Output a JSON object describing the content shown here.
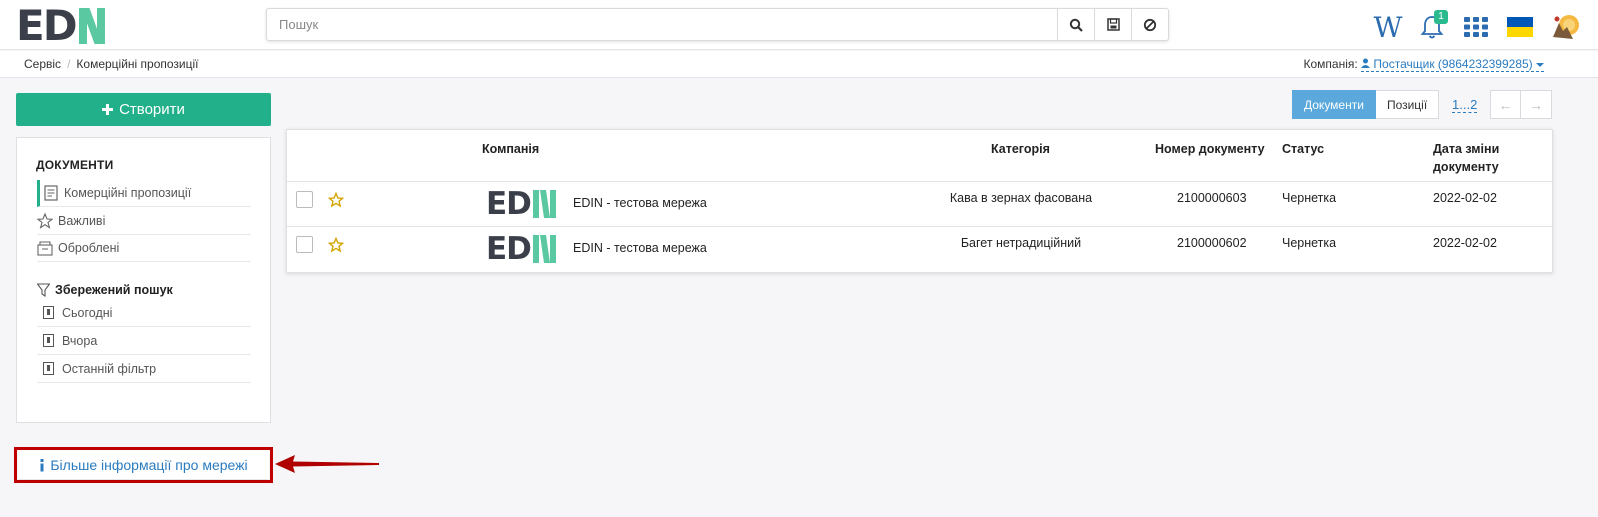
{
  "brand": {
    "logo_text": "ED",
    "accent": "#5ac8a0"
  },
  "search": {
    "placeholder": "Пошук"
  },
  "header": {
    "notifications_count": "1"
  },
  "breadcrumb": [
    "Сервіс",
    "Комерційні пропозиції"
  ],
  "company": {
    "label": "Компанія:",
    "value": "Постачщик (9864232399285)"
  },
  "create_button": "Створити",
  "sidebar": {
    "section_title": "ДОКУМЕНТИ",
    "items": [
      {
        "label": "Комерційні пропозиції",
        "icon": "document-list-icon"
      },
      {
        "label": "Важливі",
        "icon": "star-icon"
      },
      {
        "label": "Оброблені",
        "icon": "archive-icon"
      }
    ],
    "saved_title": "Збережений пошук",
    "saved_items": [
      "Сьогодні",
      "Вчора",
      "Останній фільтр"
    ]
  },
  "info_button": "Більше інформації про мережі",
  "view_toggle": {
    "documents": "Документи",
    "positions": "Позиції"
  },
  "pagination": "1...2",
  "table": {
    "headers": {
      "company": "Компанія",
      "category": "Категорія",
      "doc_number": "Номер документу",
      "status": "Статус",
      "date": "Дата зміни документу"
    },
    "rows": [
      {
        "company": "EDIN - тестова мережа",
        "category": "Кава в зернах фасована",
        "doc_number": "2100000603",
        "status": "Чернетка",
        "date": "2022-02-02"
      },
      {
        "company": "EDIN - тестова мережа",
        "category": "Багет нетрадиційний",
        "doc_number": "2100000602",
        "status": "Чернетка",
        "date": "2022-02-02"
      }
    ]
  }
}
